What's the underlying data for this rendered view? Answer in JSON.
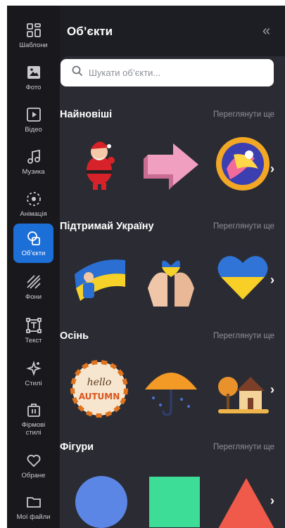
{
  "panel": {
    "title": "Об’єкти",
    "collapse": "«"
  },
  "search": {
    "placeholder": "Шукати об’єкти..."
  },
  "rail": {
    "items": [
      {
        "label": "Шаблони",
        "icon": "templates-icon"
      },
      {
        "label": "Фото",
        "icon": "photo-icon"
      },
      {
        "label": "Відео",
        "icon": "video-icon"
      },
      {
        "label": "Музика",
        "icon": "music-icon"
      },
      {
        "label": "Анімація",
        "icon": "animation-icon"
      },
      {
        "label": "Об’єкти",
        "icon": "objects-icon",
        "active": true
      },
      {
        "label": "Фони",
        "icon": "backgrounds-icon"
      },
      {
        "label": "Текст",
        "icon": "text-icon"
      },
      {
        "label": "Стилі",
        "icon": "styles-icon"
      },
      {
        "label": "Фірмові стилі",
        "icon": "brand-styles-icon"
      },
      {
        "label": "Обране",
        "icon": "heart-icon"
      },
      {
        "label": "Мої файли",
        "icon": "folder-icon"
      }
    ]
  },
  "sections": [
    {
      "title": "Найновіші",
      "more": "Переглянути ще",
      "items": [
        "santa-sticker",
        "pink-arrow-sticker",
        "colorful-swirl-sticker"
      ]
    },
    {
      "title": "Підтримай Україну",
      "more": "Переглянути ще",
      "items": [
        "flag-person-sticker",
        "hands-heart-sticker",
        "ukraine-heart-sticker"
      ]
    },
    {
      "title": "Осінь",
      "more": "Переглянути ще",
      "items": [
        "hello-autumn-sticker",
        "umbrella-sticker",
        "autumn-house-sticker"
      ]
    },
    {
      "title": "Фігури",
      "more": "Переглянути ще",
      "items": [
        "blue-circle-shape",
        "green-square-shape",
        "red-triangle-shape"
      ]
    }
  ],
  "colors": {
    "accent": "#1d6fd8",
    "rail_bg": "#19191d",
    "panel_bg": "#2b2c33",
    "circle": "#5b86e5",
    "square": "#3ddc97",
    "triangle": "#ef5a4a"
  },
  "sticker_text": {
    "hello": "hello",
    "autumn": "AUTUMN"
  }
}
